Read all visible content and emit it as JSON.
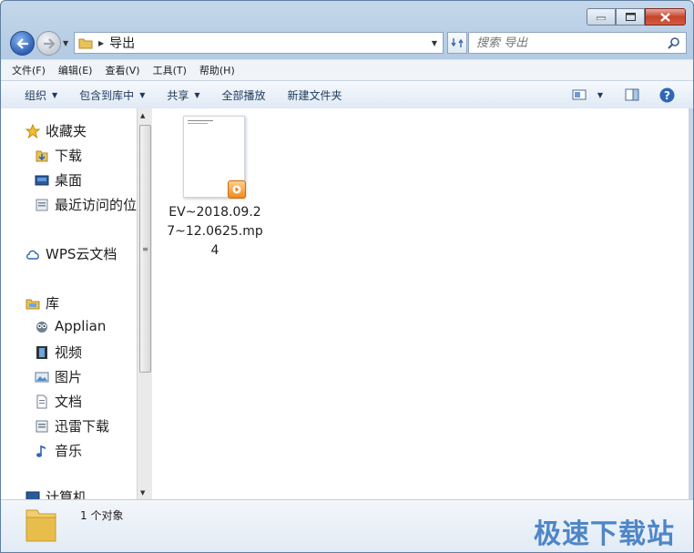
{
  "window": {
    "minimize_icon": "minimize-icon",
    "maximize_icon": "maximize-icon",
    "close_icon": "close-icon"
  },
  "address_bar": {
    "folder_icon": "folder-icon",
    "path": "导出",
    "search_placeholder": "搜索 导出"
  },
  "menu": [
    "文件(F)",
    "编辑(E)",
    "查看(V)",
    "工具(T)",
    "帮助(H)"
  ],
  "toolbar": {
    "organize": "组织",
    "include_in_library": "包含到库中",
    "share": "共享",
    "play_all": "全部播放",
    "new_folder": "新建文件夹"
  },
  "nav": {
    "favorites": "收藏夹",
    "downloads": "下载",
    "desktop": "桌面",
    "recent": "最近访问的位",
    "wps": "WPS云文档",
    "libraries": "库",
    "applian": "Applian",
    "videos": "视频",
    "pictures": "图片",
    "documents": "文档",
    "xunlei": "迅雷下载",
    "music": "音乐",
    "computer": "计算机"
  },
  "files": [
    {
      "name": "EV~2018.09.27~12.0625.mp4",
      "icon": "video-file-thumbnail"
    }
  ],
  "status": {
    "count": "1 个对象"
  },
  "watermark": "极速下载站",
  "colors": {
    "accent": "#4e86c7",
    "close": "#c7432c"
  }
}
